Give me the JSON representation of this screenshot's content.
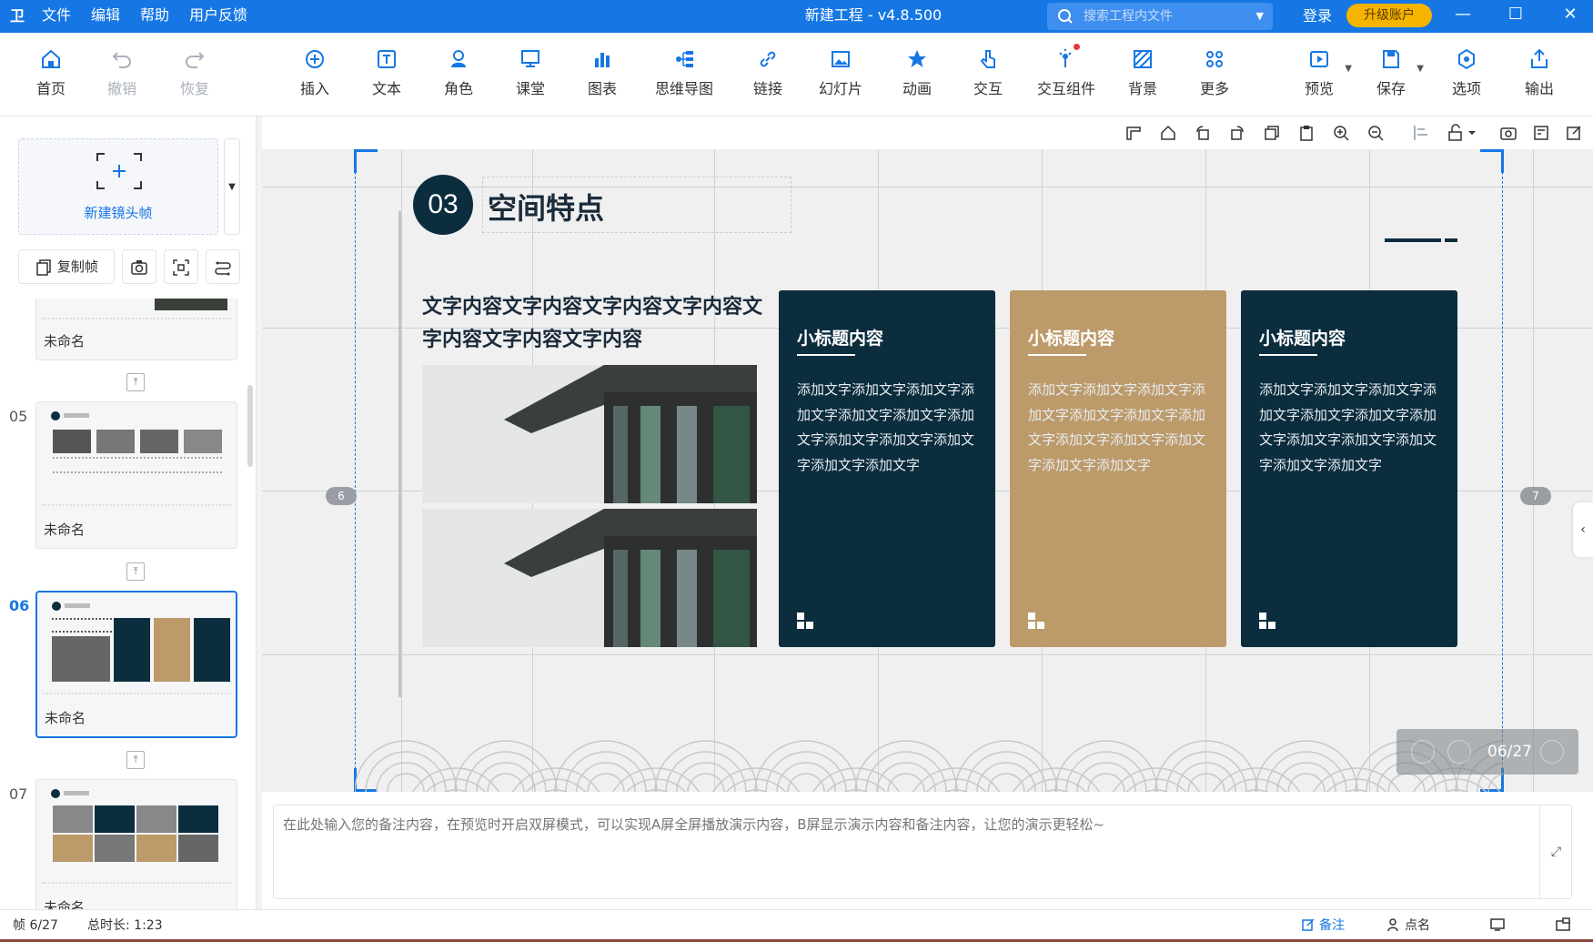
{
  "titlebar": {
    "logo": "卫",
    "menu": [
      "文件",
      "编辑",
      "帮助",
      "用户反馈"
    ],
    "title": "新建工程 - v4.8.500",
    "search_placeholder": "搜索工程内文件",
    "login": "登录",
    "upgrade": "升级账户"
  },
  "toolbar": {
    "home": "首页",
    "undo": "撤销",
    "redo": "恢复",
    "insert": "插入",
    "text": "文本",
    "role": "角色",
    "class": "课堂",
    "chart": "图表",
    "mindmap": "思维导图",
    "link": "链接",
    "slides": "幻灯片",
    "animation": "动画",
    "interact": "交互",
    "interact_comp": "交互组件",
    "background": "背景",
    "more": "更多",
    "preview": "预览",
    "save": "保存",
    "options": "选项",
    "export": "输出"
  },
  "leftpanel": {
    "new_frame": "新建镜头帧",
    "copy_frame": "复制帧",
    "slides": [
      {
        "num": "",
        "name": "未命名"
      },
      {
        "num": "05",
        "name": "未命名"
      },
      {
        "num": "06",
        "name": "未命名"
      },
      {
        "num": "07",
        "name": "未命名"
      }
    ]
  },
  "canvas": {
    "section_num": "03",
    "section_title": "空间特点",
    "body_text": "文字内容文字内容文字内容文字内容文字内容文字内容文字内容",
    "cards": [
      {
        "title": "小标题内容",
        "body": "添加文字添加文字添加文字添加文字添加文字添加文字添加文字添加文字添加文字添加文字添加文字添加文字",
        "color": "#0b2d3e"
      },
      {
        "title": "小标题内容",
        "body": "添加文字添加文字添加文字添加文字添加文字添加文字添加文字添加文字添加文字添加文字添加文字添加文字",
        "color": "#bc9a6a"
      },
      {
        "title": "小标题内容",
        "body": "添加文字添加文字添加文字添加文字添加文字添加文字添加文字添加文字添加文字添加文字添加文字添加文字",
        "color": "#0b2d3e"
      }
    ],
    "left_badge": "6",
    "right_badge": "7",
    "page_indicator": "06/27"
  },
  "notes": {
    "placeholder": "在此处输入您的备注内容，在预览时开启双屏模式，可以实现A屏全屏播放演示内容，B屏显示演示内容和备注内容，让您的演示更轻松~"
  },
  "statusbar": {
    "frame": "帧 6/27",
    "duration": "总时长: 1:23",
    "notes": "备注",
    "rollcall": "点名"
  },
  "colors": {
    "brand": "#1677e4",
    "dark_card": "#0b2d3e",
    "tan_card": "#bc9a6a",
    "upgrade": "#f5b400"
  }
}
